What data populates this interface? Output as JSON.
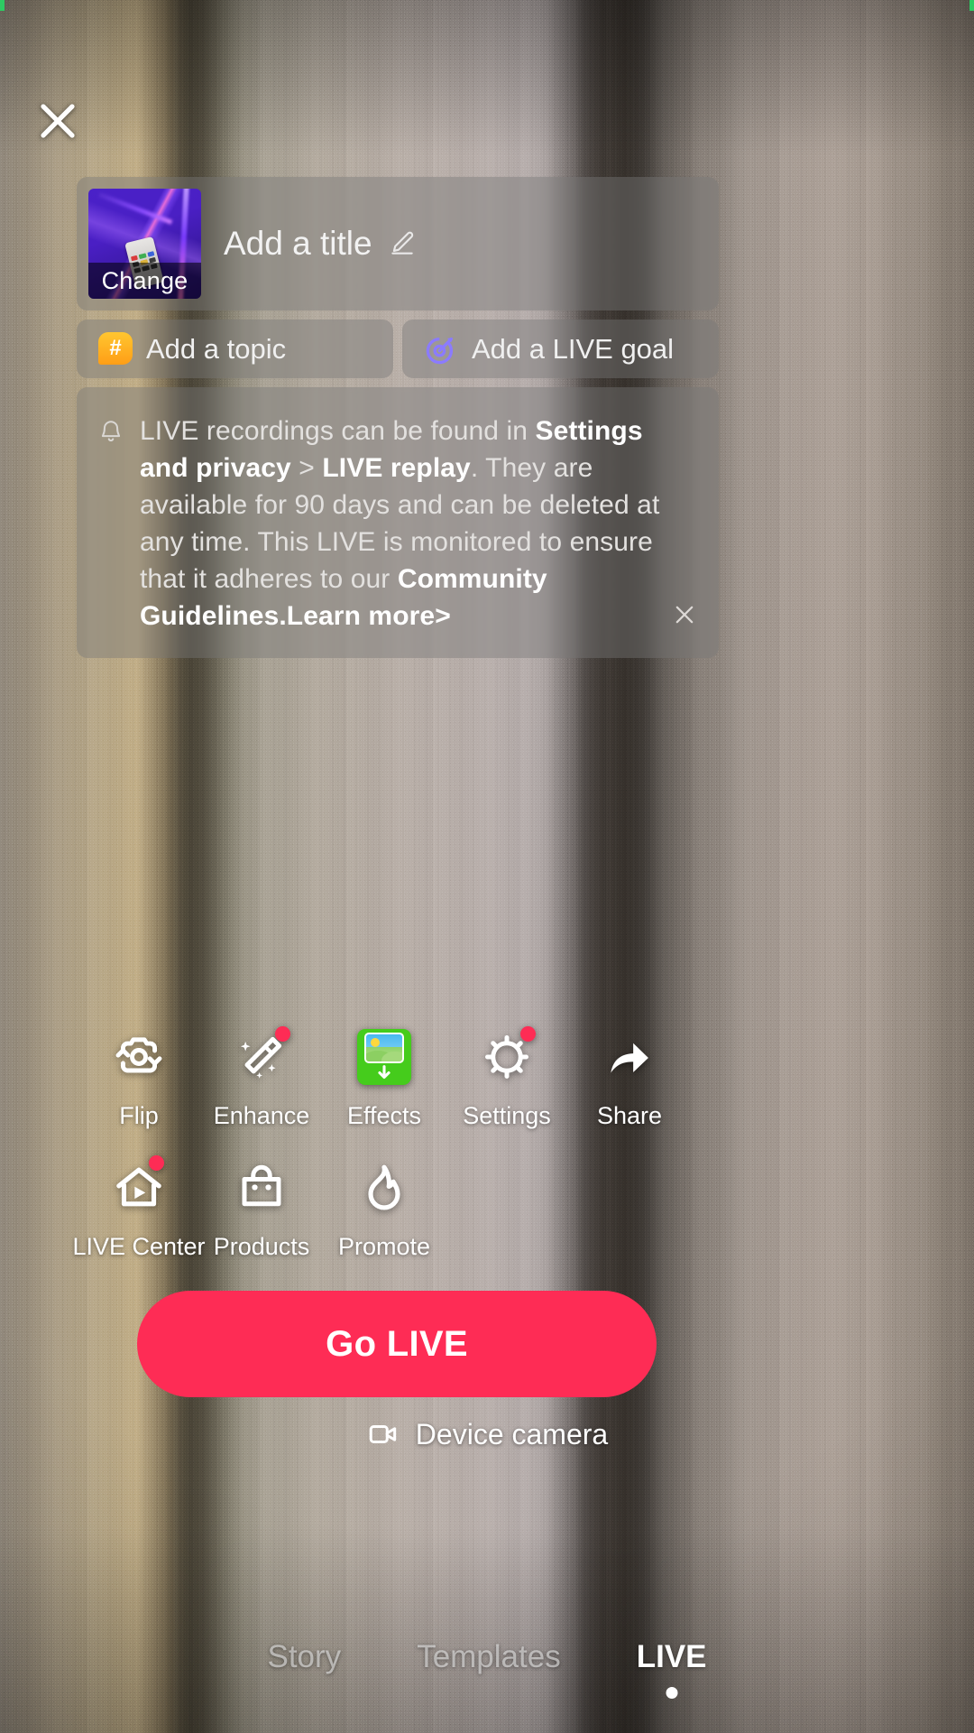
{
  "colors": {
    "accent_red": "#FE2C55",
    "badge_dot": "#FE2C55",
    "effects_green": "#45CC1C",
    "topic_orange": "#FFA61A",
    "goal_purple": "#8B7BFF"
  },
  "header": {
    "close_icon": "close-icon"
  },
  "title_card": {
    "thumbnail_label": "Change",
    "title_placeholder": "Add a title",
    "edit_icon": "pencil-icon"
  },
  "chips": [
    {
      "label": "Add a topic",
      "icon": "hashtag-bubble-icon"
    },
    {
      "label": "Add a LIVE goal",
      "icon": "target-dart-icon"
    }
  ],
  "notice": {
    "icon": "bell-icon",
    "close_icon": "close-icon",
    "segments": [
      {
        "text": "LIVE recordings can be found in ",
        "bold": false
      },
      {
        "text": "Settings and privacy",
        "bold": true
      },
      {
        "text": " > ",
        "bold": false
      },
      {
        "text": "LIVE replay",
        "bold": true
      },
      {
        "text": ". They are available for 90 days and can be deleted at any time. This LIVE is monitored to ensure that it adheres to our ",
        "bold": false
      },
      {
        "text": "Community Guidelines.Learn more>",
        "bold": true
      }
    ]
  },
  "actions": {
    "row1": [
      {
        "label": "Flip",
        "icon": "camera-flip-icon",
        "badge": false
      },
      {
        "label": "Enhance",
        "icon": "magic-wand-icon",
        "badge": true
      },
      {
        "label": "Effects",
        "icon": "effects-image-icon",
        "badge": false
      },
      {
        "label": "Settings",
        "icon": "gear-icon",
        "badge": true
      },
      {
        "label": "Share",
        "icon": "share-arrow-icon",
        "badge": false
      }
    ],
    "row2": [
      {
        "label": "LIVE Center",
        "icon": "live-center-house-icon",
        "badge": true
      },
      {
        "label": "Products",
        "icon": "shopping-bag-icon",
        "badge": false
      },
      {
        "label": "Promote",
        "icon": "flame-icon",
        "badge": false
      }
    ]
  },
  "go_live": {
    "label": "Go LIVE"
  },
  "device_camera": {
    "label": "Device camera",
    "icon": "video-camera-icon"
  },
  "tabs": [
    {
      "label": "Story",
      "active": false
    },
    {
      "label": "Templates",
      "active": false
    },
    {
      "label": "LIVE",
      "active": true
    }
  ]
}
